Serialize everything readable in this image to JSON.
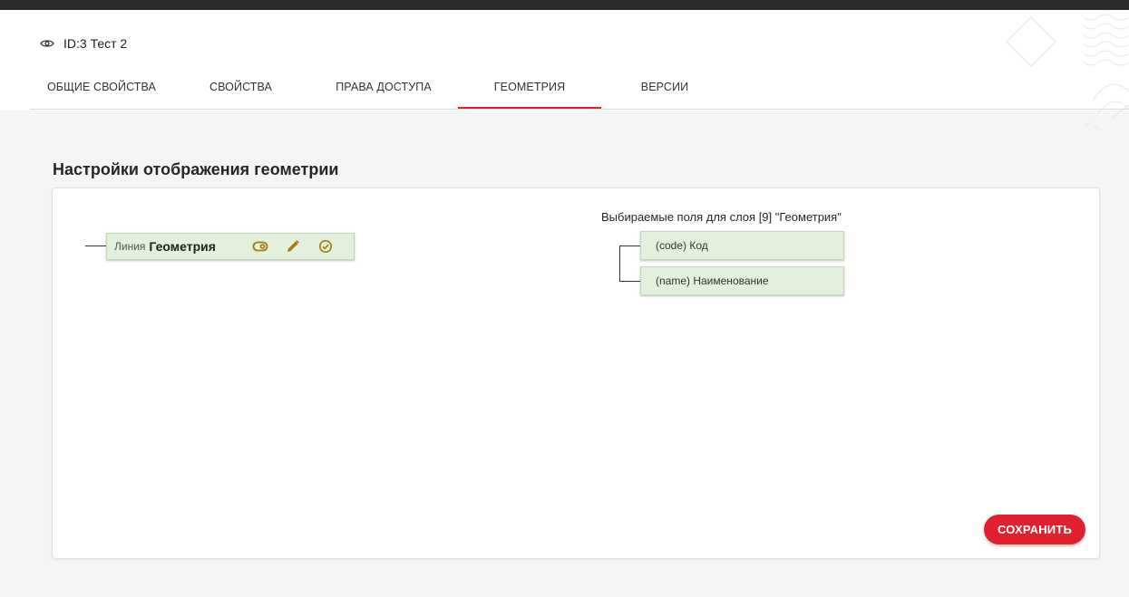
{
  "header": {
    "record_title": "ID:3 Тест 2"
  },
  "tabs": [
    {
      "label": "ОБЩИЕ СВОЙСТВА",
      "active": false
    },
    {
      "label": "СВОЙСТВА",
      "active": false
    },
    {
      "label": "ПРАВА ДОСТУПА",
      "active": false
    },
    {
      "label": "ГЕОМЕТРИЯ",
      "active": true
    },
    {
      "label": "ВЕРСИИ",
      "active": false
    }
  ],
  "section": {
    "title": "Настройки отображения геометрии"
  },
  "layer_node": {
    "type_label": "Линия",
    "name": "Геометрия",
    "icons": [
      "toggle-visibility-icon",
      "pencil-icon",
      "check-circle-icon"
    ]
  },
  "fields_panel": {
    "label": "Выбираемые поля для слоя [9] \"Геометрия\"",
    "fields": [
      {
        "label": "(code) Код"
      },
      {
        "label": "(name) Наименование"
      }
    ]
  },
  "actions": {
    "save_label": "СОХРАНИТЬ"
  },
  "colors": {
    "accent": "#e0202e",
    "node_bg": "#e2f0dc",
    "icon_color": "#a57a08"
  }
}
